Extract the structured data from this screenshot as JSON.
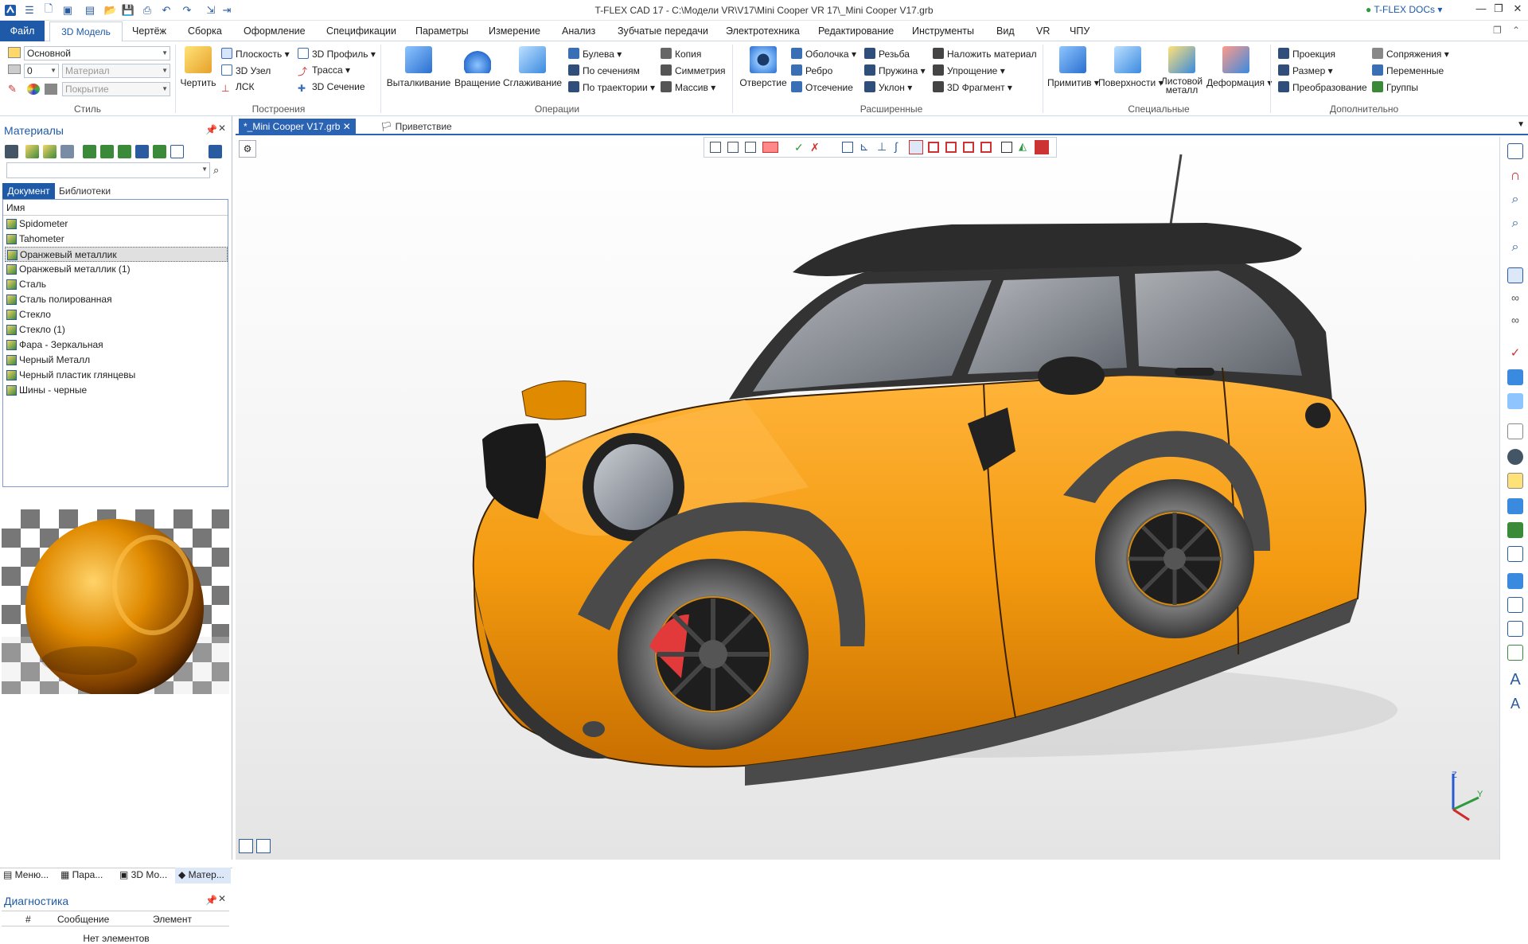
{
  "window": {
    "title": "T-FLEX CAD 17 - C:\\Модели VR\\V17\\Mini Cooper VR 17\\_Mini Cooper V17.grb",
    "docs_label": "T-FLEX DOCs",
    "minimize": "—",
    "maximize": "❐",
    "close": "✕"
  },
  "menu": {
    "file": "Файл",
    "items": [
      "3D Модель",
      "Чертёж",
      "Сборка",
      "Оформление",
      "Спецификации",
      "Параметры",
      "Измерение",
      "Анализ",
      "Зубчатые передачи",
      "Электротехника",
      "Редактирование",
      "Инструменты",
      "Вид",
      "VR",
      "ЧПУ"
    ]
  },
  "ribbon": {
    "style": {
      "layer": "Основной",
      "level": "0",
      "material": "Материал",
      "coating": "Покрытие",
      "group": "Стиль"
    },
    "construct": {
      "draw": "Чертить",
      "plane": "Плоскость",
      "node3d": "3D Узел",
      "lsk": "ЛСК",
      "profile3d": "3D Профиль",
      "path": "Трасса",
      "section3d": "3D Сечение",
      "group": "Построения"
    },
    "operations": {
      "extrude": "Выталкивание",
      "rotate": "Вращение",
      "smooth": "Сглаживание",
      "boolean": "Булева",
      "by_sections": "По сечениям",
      "by_path": "По траектории",
      "copy": "Копия",
      "symmetry": "Симметрия",
      "array": "Массив",
      "group": "Операции"
    },
    "extended": {
      "hole": "Отверстие",
      "shell": "Оболочка",
      "rib": "Ребро",
      "cut": "Отсечение",
      "thread": "Резьба",
      "spring": "Пружина",
      "draft": "Уклон",
      "apply_material": "Наложить материал",
      "simplify": "Упрощение",
      "fragment3d": "3D Фрагмент",
      "group": "Расширенные"
    },
    "special": {
      "primitive": "Примитив",
      "surfaces": "Поверхности",
      "sheet_metal": "Листовой металл",
      "deform": "Деформация",
      "group": "Специальные"
    },
    "additional": {
      "projection": "Проекция",
      "dimension": "Размер",
      "transform": "Преобразование",
      "mates": "Сопряжения",
      "variables": "Переменные",
      "groups": "Группы",
      "group": "Дополнительно"
    }
  },
  "doc_tabs": [
    {
      "label": "*_Mini Cooper V17.grb",
      "active": true
    },
    {
      "label": "Приветствие",
      "active": false
    }
  ],
  "materials_panel": {
    "title": "Материалы",
    "search_value": "",
    "tabs": [
      "Документ",
      "Библиотеки"
    ],
    "column": "Имя",
    "items": [
      "Spidometer",
      "Tahometer",
      "Оранжевый металлик",
      "Оранжевый металлик (1)",
      "Сталь",
      "Сталь полированная",
      "Стекло",
      "Стекло (1)",
      "Фара - Зеркальная",
      "Черный Металл",
      "Черный пластик глянцевы",
      "Шины - черные"
    ],
    "selected_index": 2,
    "bottom_tabs": [
      "Меню...",
      "Пара...",
      "3D Мо...",
      "Матер..."
    ]
  },
  "diagnostics": {
    "title": "Диагностика",
    "columns": [
      "#",
      "Сообщение",
      "Элемент"
    ],
    "empty": "Нет элементов"
  },
  "viewport": {
    "axis_z": "Z",
    "axis_y": "Y",
    "body_color": "#f39a10",
    "roof_color": "#2c2c2c"
  }
}
